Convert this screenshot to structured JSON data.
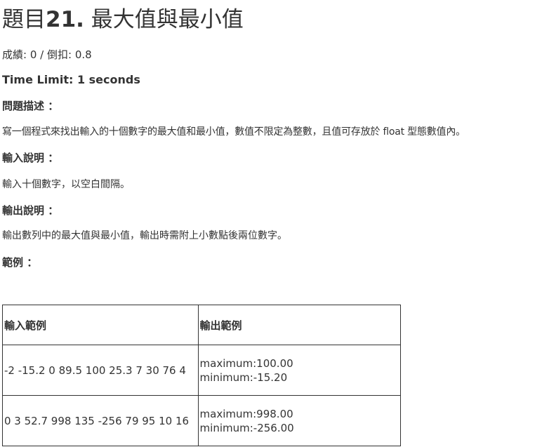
{
  "title": {
    "prefix": "題目",
    "number": "21.",
    "name": "最大值與最小值"
  },
  "score": {
    "score_label": "成績:",
    "score_value": "0",
    "separator": "/",
    "penalty_label": "倒扣:",
    "penalty_value": "0.8"
  },
  "time_limit": "Time Limit: 1 seconds",
  "sections": {
    "description_heading": "問題描述 ：",
    "description_text": "寫一個程式來找出輸入的十個數字的最大值和最小值，數值不限定為整數，且值可存放於 float 型態數值內。",
    "input_heading": "輸入說明 ：",
    "input_text": "輸入十個數字，以空白間隔。",
    "output_heading": "輸出說明 ：",
    "output_text": "輸出數列中的最大值與最小值，輸出時需附上小數點後兩位數字。",
    "example_heading": "範例 ："
  },
  "examples": {
    "headers": [
      "輸入範例",
      "輸出範例"
    ],
    "rows": [
      {
        "input": "-2 -15.2 0 89.5 100 25.3 7 30 76 4",
        "output_line1": "maximum:100.00",
        "output_line2": "minimum:-15.20"
      },
      {
        "input": "0 3 52.7 998 135 -256 79 95 10 16",
        "output_line1": "maximum:998.00",
        "output_line2": "minimum:-256.00"
      }
    ]
  }
}
